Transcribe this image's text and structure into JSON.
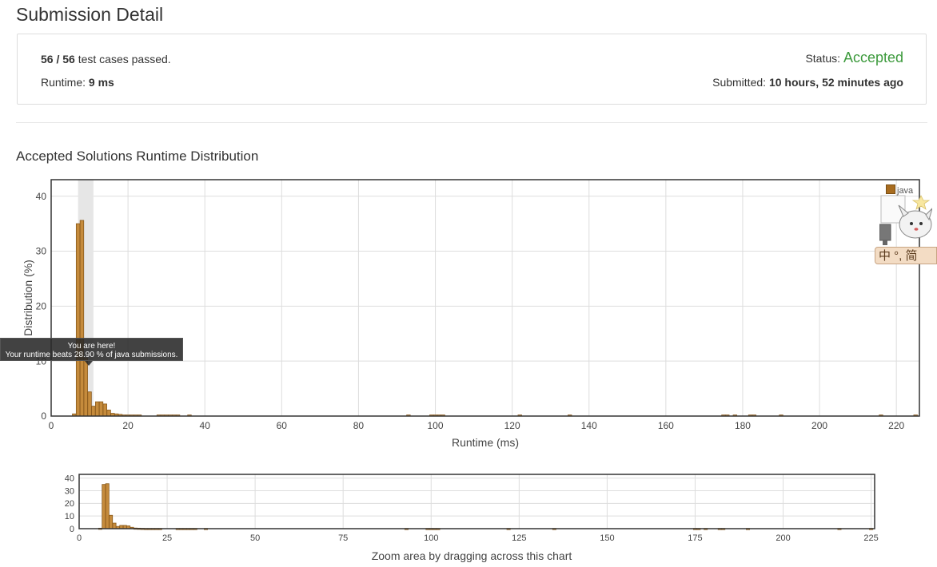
{
  "header": {
    "title": "Submission Detail"
  },
  "summary": {
    "cases_passed": "56 / 56",
    "cases_suffix": "test cases passed.",
    "runtime_label": "Runtime:",
    "runtime_value": "9 ms",
    "status_label": "Status:",
    "status_value": "Accepted",
    "submitted_label": "Submitted:",
    "submitted_value": "10 hours, 52 minutes ago"
  },
  "section": {
    "title": "Accepted Solutions Runtime Distribution"
  },
  "tooltip": {
    "line1": "You are here!",
    "line2": "Your runtime beats 28.90 % of java submissions."
  },
  "legend": {
    "label": "java"
  },
  "ime": {
    "text": "中 °, 简"
  },
  "navigator": {
    "caption": "Zoom area by dragging across this chart"
  },
  "colors": {
    "bar": "#c58b3c",
    "bar_border": "#8a5a1c",
    "accepted": "#3c9a3c",
    "highlight": "#e6e6e6"
  },
  "chart_data": [
    {
      "type": "bar",
      "xlabel": "Runtime (ms)",
      "ylabel": "Distribution (%)",
      "xlim": [
        0,
        226
      ],
      "ylim": [
        0,
        43
      ],
      "xticks": [
        0,
        20,
        40,
        60,
        80,
        100,
        120,
        140,
        160,
        180,
        200,
        220
      ],
      "yticks": [
        0,
        10,
        20,
        30,
        40
      ],
      "highlight_range": [
        7,
        11
      ],
      "series": [
        {
          "name": "java",
          "x": [
            6,
            7,
            8,
            9,
            10,
            11,
            12,
            13,
            14,
            15,
            16,
            17,
            18,
            19,
            20,
            21,
            22,
            23,
            28,
            29,
            30,
            31,
            32,
            33,
            36,
            93,
            99,
            100,
            101,
            102,
            122,
            135,
            175,
            176,
            178,
            182,
            183,
            190,
            216,
            225
          ],
          "values": [
            0.4,
            35.0,
            35.6,
            10.6,
            4.4,
            1.8,
            2.6,
            2.6,
            2.2,
            1.1,
            0.5,
            0.4,
            0.3,
            0.2,
            0.2,
            0.2,
            0.2,
            0.2,
            0.2,
            0.2,
            0.2,
            0.2,
            0.2,
            0.2,
            0.2,
            0.2,
            0.2,
            0.2,
            0.2,
            0.2,
            0.2,
            0.2,
            0.2,
            0.2,
            0.2,
            0.2,
            0.2,
            0.2,
            0.2,
            0.2
          ]
        }
      ]
    },
    {
      "type": "bar",
      "xlabel": "",
      "ylabel": "",
      "xlim": [
        0,
        226
      ],
      "ylim": [
        0,
        43
      ],
      "xticks": [
        0,
        25,
        50,
        75,
        100,
        125,
        150,
        175,
        200,
        225
      ],
      "yticks": [
        0,
        10,
        20,
        30,
        40
      ]
    }
  ]
}
